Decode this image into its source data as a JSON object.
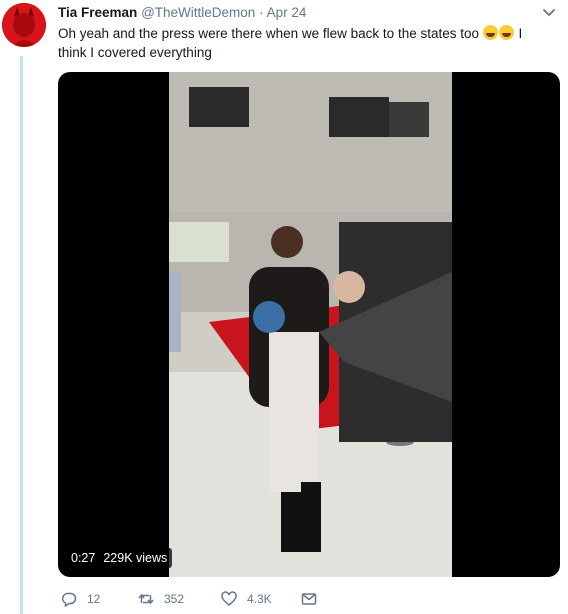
{
  "tweet": {
    "author_name": "Tia Freeman",
    "handle": "@TheWittleDemon",
    "separator": "·",
    "date": "Apr 24",
    "text_line1": "Oh yeah and the press were there when we flew back to the states too",
    "text_line1_end": "I",
    "text_line2": "think I covered everything",
    "emoji_count": 2
  },
  "media": {
    "duration": "0:27",
    "views": "229K views"
  },
  "actions": {
    "replies": "12",
    "retweets": "352",
    "likes": "4.3K"
  },
  "colors": {
    "thread_line": "#c4e1f5",
    "avatar_bg": "#d6141a",
    "secondary_text": "#657786"
  }
}
